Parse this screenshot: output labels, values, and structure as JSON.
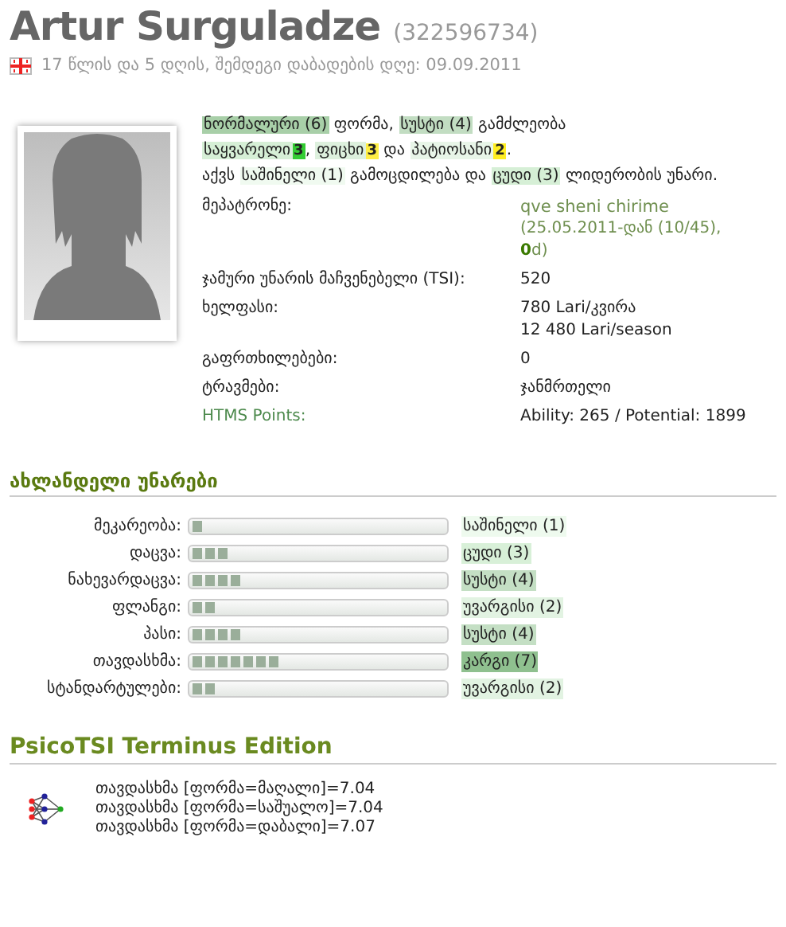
{
  "player": {
    "name": "Artur Surguladze",
    "id": "(322596734)",
    "age_line": "17 წლის და 5 დღის, შემდეგი დაბადების დღე: 09.09.2011"
  },
  "summary": [
    {
      "segments": [
        {
          "text": "ნორმალური (6)",
          "color": "#a8cfa8"
        },
        {
          "text": " ფორმა, "
        },
        {
          "text": "სუსტი (4)",
          "color": "#c2ddc2"
        },
        {
          "text": " გამძლეობა"
        }
      ]
    },
    {
      "segments": [
        {
          "text": "საყვარელი",
          "color": "#d6efd6"
        },
        {
          "text": "3",
          "kind": "badge",
          "color": "#33cc33"
        },
        {
          "text": ", "
        },
        {
          "text": "ფიცხი",
          "color": "#ddf0dd"
        },
        {
          "text": "3",
          "kind": "badge",
          "color": "#ffee44"
        },
        {
          "text": " და "
        },
        {
          "text": "პატიოსანი",
          "color": "#e8f5e8"
        },
        {
          "text": "2",
          "kind": "badge",
          "color": "#ffee22"
        },
        {
          "text": "."
        }
      ]
    },
    {
      "segments": [
        {
          "text": "აქვს "
        },
        {
          "text": "საშინელი (1)",
          "color": "#f0faf0"
        },
        {
          "text": " გამოცდილება და "
        },
        {
          "text": "ცუდი (3)",
          "color": "#d6efd6"
        },
        {
          "text": " ლიდერობის უნარი."
        }
      ]
    }
  ],
  "details": [
    {
      "label": "მეპატრონე:",
      "kind": "owner",
      "link": "qve sheni chirime",
      "values": [
        "(25.05.2011-დან (10/45),",
        "**0**d)"
      ]
    },
    {
      "label": "ჯამური უნარის მაჩვენებელი (TSI):",
      "values": [
        "520"
      ]
    },
    {
      "label": "ხელფასი:",
      "values": [
        "780 Lari/კვირა",
        "12 480 Lari/season"
      ]
    },
    {
      "label": "გაფრთხილებები:",
      "values": [
        "0"
      ]
    },
    {
      "label": "ტრავმები:",
      "values": [
        "ჯანმრთელი"
      ]
    },
    {
      "label": "HTMS Points:",
      "kind": "htms",
      "values": [
        "Ability: 265 / Potential: 1899"
      ]
    }
  ],
  "skills_title": "ახლანდელი უნარები",
  "skills": [
    {
      "label": "მეკარეობა:",
      "level": 0.05,
      "rating": "საშინელი (1)",
      "color": "#eefaee"
    },
    {
      "label": "დაცვა:",
      "level": 0.15,
      "rating": "ცუდი (3)",
      "color": "#d8f0d8"
    },
    {
      "label": "ნახევარდაცვა:",
      "level": 0.2,
      "rating": "სუსტი (4)",
      "color": "#c4dfc4"
    },
    {
      "label": "ფლანგი:",
      "level": 0.1,
      "rating": "უვარგისი (2)",
      "color": "#e2f3e2"
    },
    {
      "label": "პასი:",
      "level": 0.2,
      "rating": "სუსტი (4)",
      "color": "#c4dfc4"
    },
    {
      "label": "თავდასხმა:",
      "level": 0.35,
      "rating": "კარგი (7)",
      "color": "#8fc08f"
    },
    {
      "label": "სტანდარტულები:",
      "level": 0.1,
      "rating": "უვარგისი (2)",
      "color": "#e2f3e2"
    }
  ],
  "psico": {
    "title": "PsicoTSI Terminus Edition",
    "lines": [
      "თავდასხმა [ფორმა=მაღალი]=7.04",
      "თავდასხმა [ფორმა=საშუალო]=7.04",
      "თავდასხმა [ფორმა=დაბალი]=7.07"
    ]
  }
}
